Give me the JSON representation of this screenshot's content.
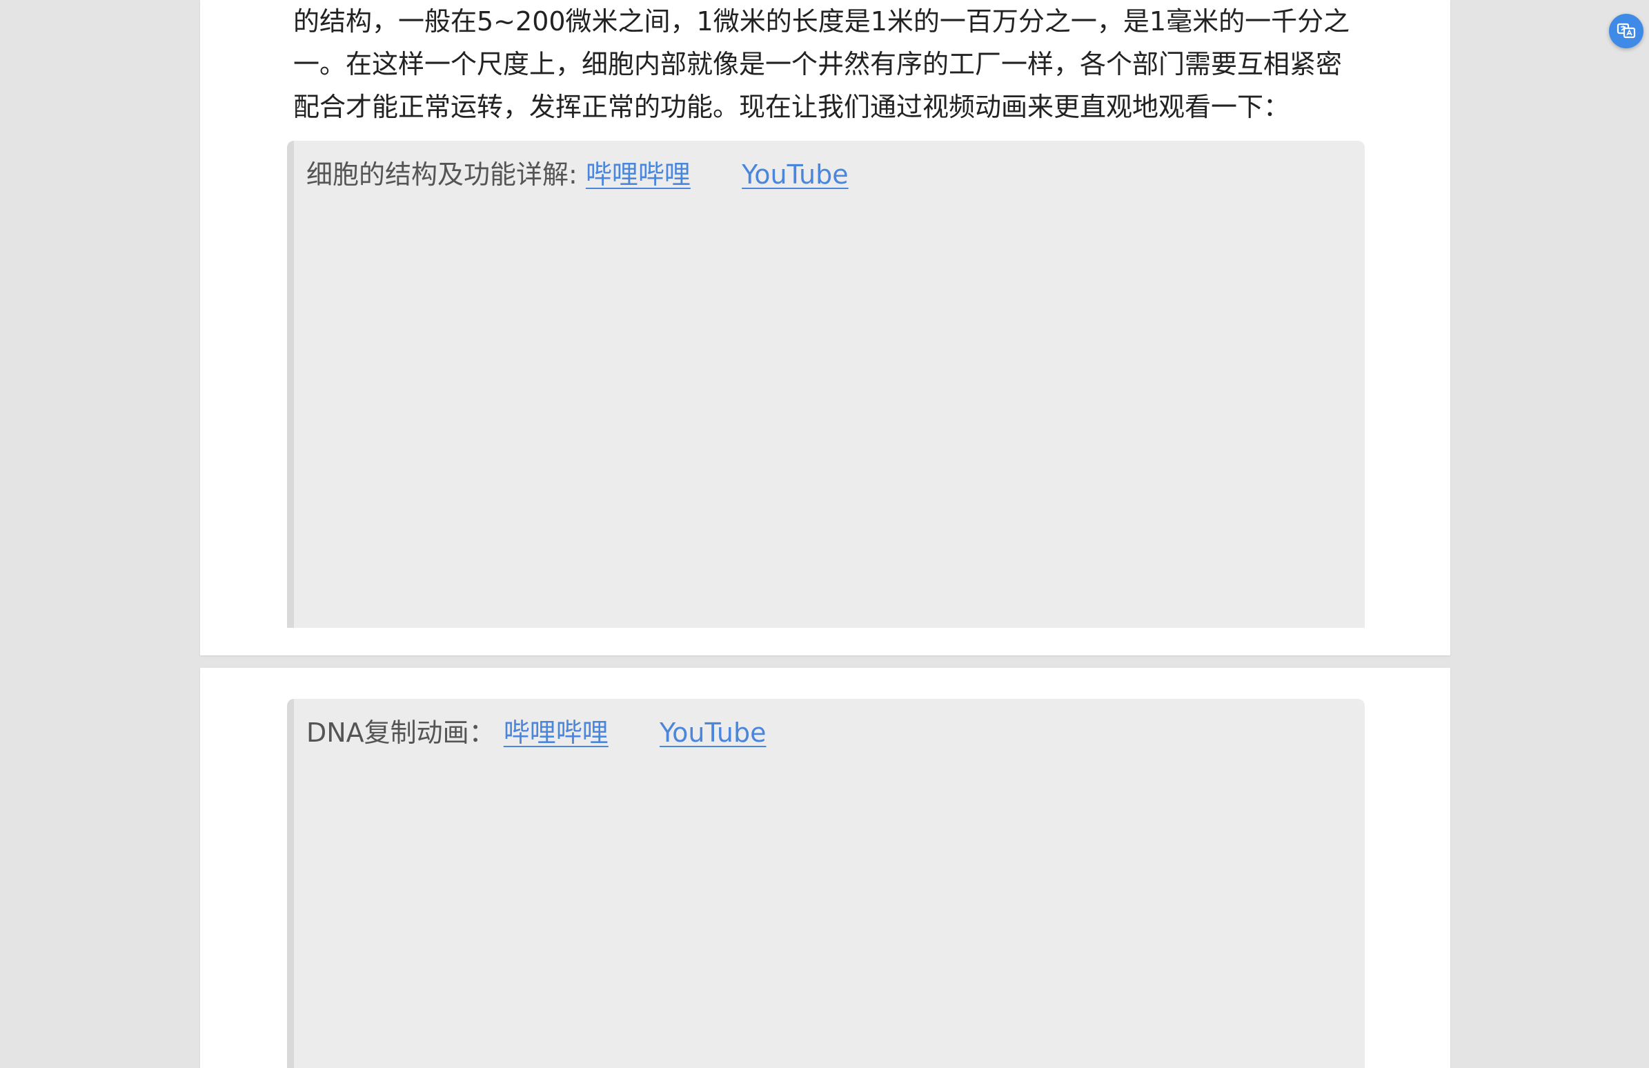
{
  "article": {
    "paragraph_lines": [
      "的结构，一般在5~200微米之间，1微米的长度是1米的一百万分之一，是1毫米的一千分之",
      "一。在这样一个尺度上，细胞内部就像是一个井然有序的工厂一样，各个部门需要互相紧密",
      "配合才能正常运转，发挥正常的功能。现在让我们通过视频动画来更直观地观看一下："
    ]
  },
  "videos": [
    {
      "caption": "细胞的结构及功能详解:",
      "links": [
        "哔哩哔哩",
        "YouTube"
      ]
    },
    {
      "caption": "DNA复制动画：",
      "links": [
        "哔哩哔哩",
        "YouTube"
      ]
    }
  ],
  "floating_button": {
    "icon": "translate-icon"
  },
  "colors": {
    "link": "#4a86dc",
    "page_background": "#e4e4e4",
    "card": "#ffffff",
    "video_placeholder": "#ececec",
    "float_button": "#3f8ae6"
  }
}
